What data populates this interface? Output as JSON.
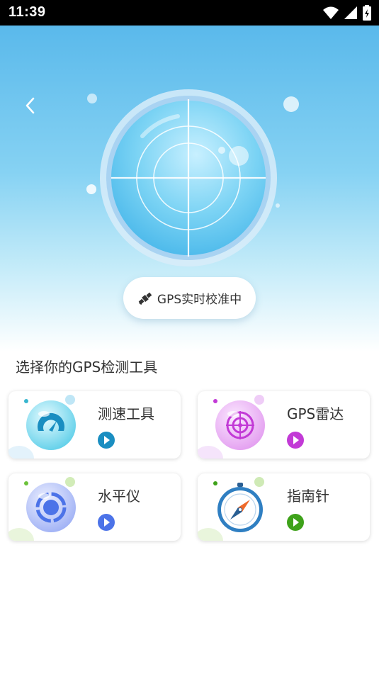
{
  "status_bar": {
    "time": "11:39"
  },
  "header": {
    "status_label": "GPS实时校准中"
  },
  "section": {
    "title": "选择你的GPS检测工具"
  },
  "tools": [
    {
      "label": "测速工具",
      "icon": "speedometer-icon",
      "accent": "#1a8ec1"
    },
    {
      "label": "GPS雷达",
      "icon": "radar-icon",
      "accent": "#c23ad6"
    },
    {
      "label": "水平仪",
      "icon": "level-icon",
      "accent": "#4c73e8"
    },
    {
      "label": "指南针",
      "icon": "compass-icon",
      "accent": "#3ea21a"
    }
  ],
  "colors": {
    "hero_top": "#5ab9eb",
    "hero_bottom": "#ffffff"
  }
}
